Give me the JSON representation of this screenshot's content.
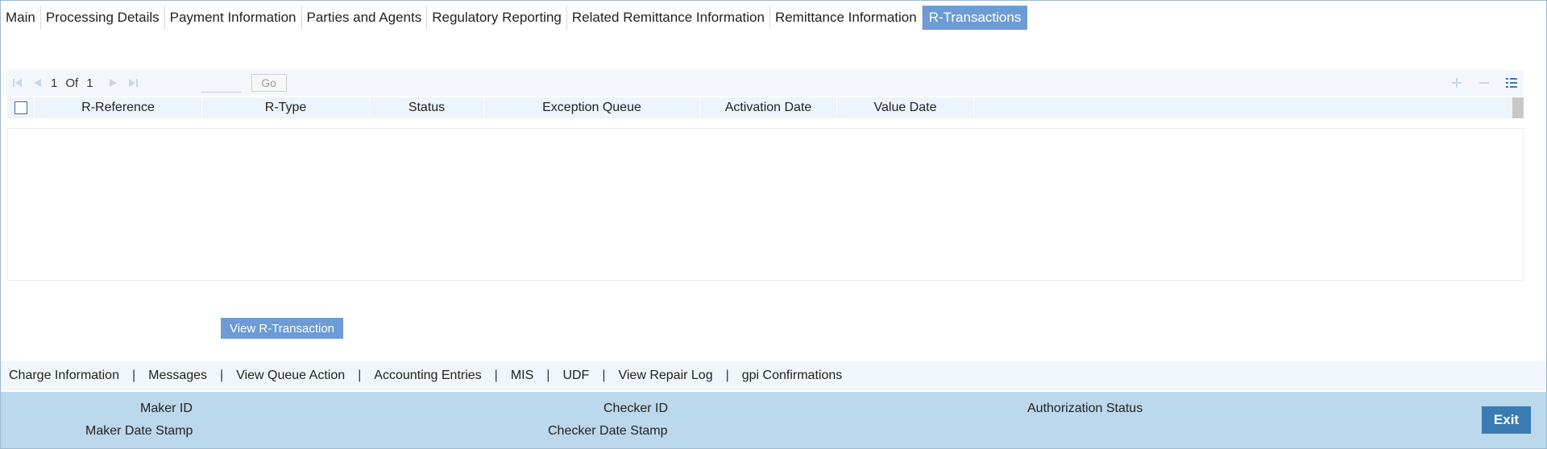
{
  "tabs": [
    {
      "label": "Main"
    },
    {
      "label": "Processing Details"
    },
    {
      "label": "Payment Information"
    },
    {
      "label": "Parties and Agents"
    },
    {
      "label": "Regulatory Reporting"
    },
    {
      "label": "Related Remittance Information"
    },
    {
      "label": "Remittance Information"
    },
    {
      "label": "R-Transactions",
      "active": true
    }
  ],
  "pager": {
    "current": "1",
    "of_label": "Of",
    "total": "1",
    "go_label": "Go"
  },
  "grid": {
    "columns": [
      "R-Reference",
      "R-Type",
      "Status",
      "Exception Queue",
      "Activation Date",
      "Value Date"
    ],
    "rows": []
  },
  "actions": {
    "view_r_transaction": "View R-Transaction"
  },
  "bottom_links": [
    "Charge Information",
    "Messages",
    "View Queue Action",
    "Accounting Entries",
    "MIS",
    "UDF",
    "View Repair Log",
    "gpi Confirmations"
  ],
  "footer": {
    "maker_id": "Maker ID",
    "maker_date_stamp": "Maker Date Stamp",
    "checker_id": "Checker ID",
    "checker_date_stamp": "Checker Date Stamp",
    "authorization_status": "Authorization Status",
    "exit_label": "Exit"
  },
  "colors": {
    "active_tab": "#6d9bd6",
    "footer_bg": "#bcd8ec",
    "exit_button": "#3a7bb4"
  },
  "icons": [
    "first-page-icon",
    "prev-page-icon",
    "next-page-icon",
    "last-page-icon",
    "add-row-icon",
    "delete-row-icon",
    "single-view-icon"
  ]
}
